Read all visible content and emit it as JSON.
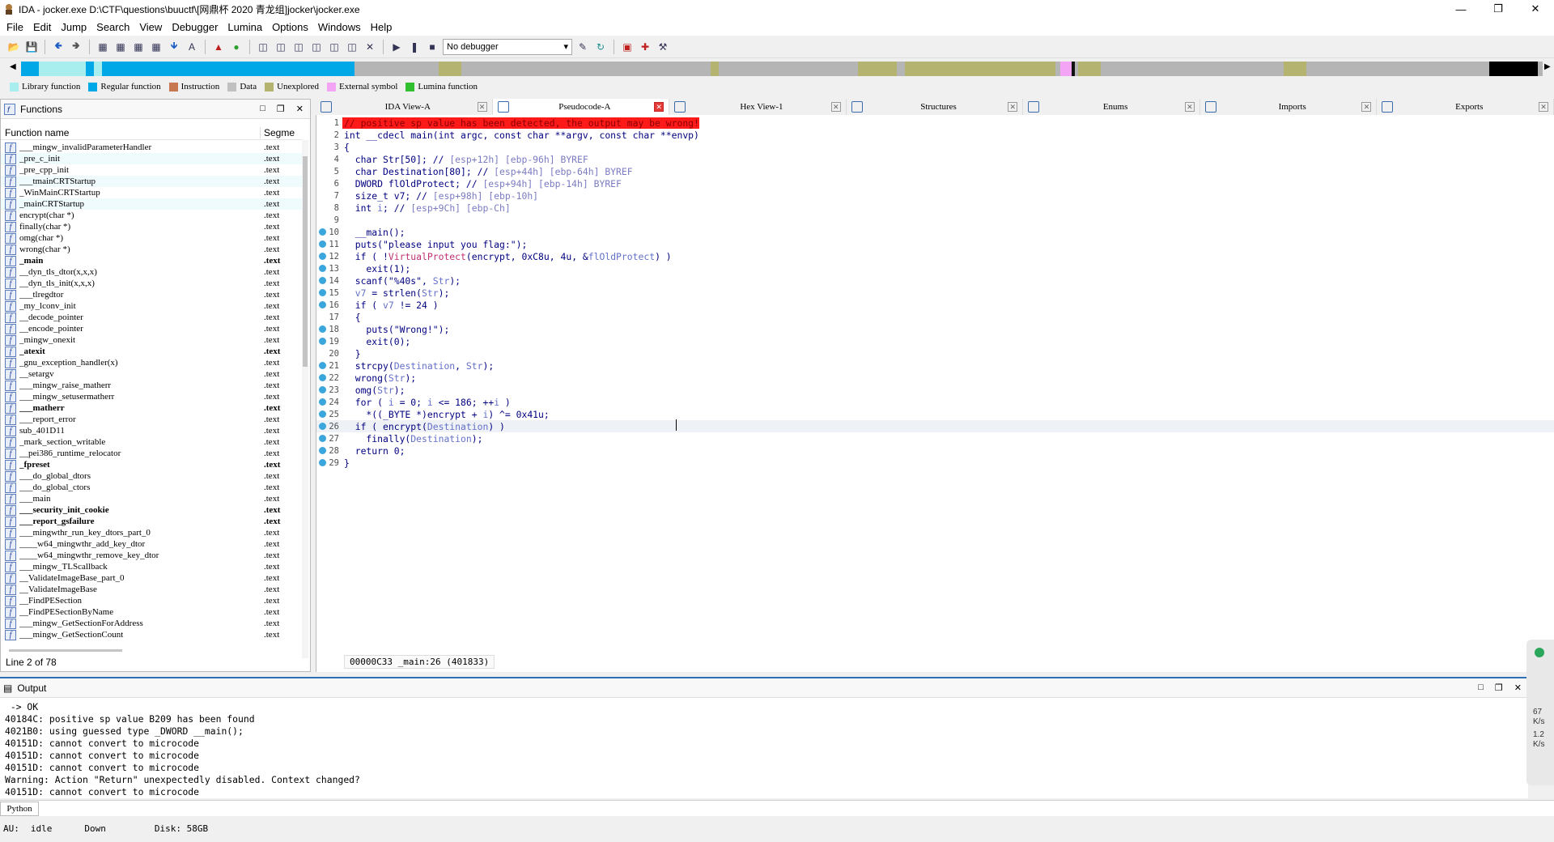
{
  "window": {
    "title": "IDA - jocker.exe D:\\CTF\\questions\\buuctf\\[网鼎杯 2020 青龙组]jocker\\jocker.exe"
  },
  "menu": [
    "File",
    "Edit",
    "Jump",
    "Search",
    "View",
    "Debugger",
    "Lumina",
    "Options",
    "Windows",
    "Help"
  ],
  "toolbar": {
    "debugger_select": "No debugger"
  },
  "legend": [
    {
      "label": "Library function",
      "color": "#a8eeee"
    },
    {
      "label": "Regular function",
      "color": "#00a8e8"
    },
    {
      "label": "Instruction",
      "color": "#c87850"
    },
    {
      "label": "Data",
      "color": "#c0c0c0"
    },
    {
      "label": "Unexplored",
      "color": "#b4b470"
    },
    {
      "label": "External symbol",
      "color": "#f4a4f4"
    },
    {
      "label": "Lumina function",
      "color": "#30c030"
    }
  ],
  "functions": {
    "title": "Functions",
    "col_name": "Function name",
    "col_segment": "Segme",
    "status": "Line 2 of 78",
    "items": [
      {
        "name": "___mingw_invalidParameterHandler",
        "seg": ".text",
        "bold": false
      },
      {
        "name": "_pre_c_init",
        "seg": ".text",
        "bold": false
      },
      {
        "name": "_pre_cpp_init",
        "seg": ".text",
        "bold": false
      },
      {
        "name": "___tmainCRTStartup",
        "seg": ".text",
        "bold": false
      },
      {
        "name": "_WinMainCRTStartup",
        "seg": ".text",
        "bold": false
      },
      {
        "name": "_mainCRTStartup",
        "seg": ".text",
        "bold": false
      },
      {
        "name": "encrypt(char *)",
        "seg": ".text",
        "bold": false
      },
      {
        "name": "finally(char *)",
        "seg": ".text",
        "bold": false
      },
      {
        "name": "omg(char *)",
        "seg": ".text",
        "bold": false
      },
      {
        "name": "wrong(char *)",
        "seg": ".text",
        "bold": false
      },
      {
        "name": "_main",
        "seg": ".text",
        "bold": true
      },
      {
        "name": "__dyn_tls_dtor(x,x,x)",
        "seg": ".text",
        "bold": false
      },
      {
        "name": "__dyn_tls_init(x,x,x)",
        "seg": ".text",
        "bold": false
      },
      {
        "name": "___tlregdtor",
        "seg": ".text",
        "bold": false
      },
      {
        "name": "_my_lconv_init",
        "seg": ".text",
        "bold": false
      },
      {
        "name": "__decode_pointer",
        "seg": ".text",
        "bold": false
      },
      {
        "name": "__encode_pointer",
        "seg": ".text",
        "bold": false
      },
      {
        "name": "_mingw_onexit",
        "seg": ".text",
        "bold": false
      },
      {
        "name": "_atexit",
        "seg": ".text",
        "bold": true
      },
      {
        "name": "_gnu_exception_handler(x)",
        "seg": ".text",
        "bold": false
      },
      {
        "name": "__setargv",
        "seg": ".text",
        "bold": false
      },
      {
        "name": "___mingw_raise_matherr",
        "seg": ".text",
        "bold": false
      },
      {
        "name": "___mingw_setusermatherr",
        "seg": ".text",
        "bold": false
      },
      {
        "name": "___matherr",
        "seg": ".text",
        "bold": true
      },
      {
        "name": "___report_error",
        "seg": ".text",
        "bold": false
      },
      {
        "name": "sub_401D11",
        "seg": ".text",
        "bold": false
      },
      {
        "name": "_mark_section_writable",
        "seg": ".text",
        "bold": false
      },
      {
        "name": "__pei386_runtime_relocator",
        "seg": ".text",
        "bold": false
      },
      {
        "name": "_fpreset",
        "seg": ".text",
        "bold": true
      },
      {
        "name": "___do_global_dtors",
        "seg": ".text",
        "bold": false
      },
      {
        "name": "___do_global_ctors",
        "seg": ".text",
        "bold": false
      },
      {
        "name": "___main",
        "seg": ".text",
        "bold": false
      },
      {
        "name": "___security_init_cookie",
        "seg": ".text",
        "bold": true
      },
      {
        "name": "___report_gsfailure",
        "seg": ".text",
        "bold": true
      },
      {
        "name": "___mingwthr_run_key_dtors_part_0",
        "seg": ".text",
        "bold": false
      },
      {
        "name": "____w64_mingwthr_add_key_dtor",
        "seg": ".text",
        "bold": false
      },
      {
        "name": "____w64_mingwthr_remove_key_dtor",
        "seg": ".text",
        "bold": false
      },
      {
        "name": "___mingw_TLScallback",
        "seg": ".text",
        "bold": false
      },
      {
        "name": "__ValidateImageBase_part_0",
        "seg": ".text",
        "bold": false
      },
      {
        "name": "__ValidateImageBase",
        "seg": ".text",
        "bold": false
      },
      {
        "name": "__FindPESection",
        "seg": ".text",
        "bold": false
      },
      {
        "name": "__FindPESectionByName",
        "seg": ".text",
        "bold": false
      },
      {
        "name": "___mingw_GetSectionForAddress",
        "seg": ".text",
        "bold": false
      },
      {
        "name": "___mingw_GetSectionCount",
        "seg": ".text",
        "bold": false
      }
    ]
  },
  "tabs": [
    {
      "label": "IDA View-A",
      "active": false
    },
    {
      "label": "Pseudocode-A",
      "active": true
    },
    {
      "label": "Hex View-1",
      "active": false
    },
    {
      "label": "Structures",
      "active": false
    },
    {
      "label": "Enums",
      "active": false
    },
    {
      "label": "Imports",
      "active": false
    },
    {
      "label": "Exports",
      "active": false
    }
  ],
  "code": {
    "address_bar": "00000C33 _main:26 (401833)",
    "lines": [
      {
        "n": "1",
        "dot": false,
        "warn": true,
        "html": "// positive sp value has been detected, the output may be wrong!"
      },
      {
        "n": "2",
        "dot": false,
        "warn": false,
        "html": "int __cdecl main(int argc, const char **argv, const char **envp)"
      },
      {
        "n": "3",
        "dot": false,
        "warn": false,
        "html": "{"
      },
      {
        "n": "4",
        "dot": false,
        "warn": false,
        "html": "  char Str[50]; // <span class='c-gy'>[esp+12h] [ebp-96h] BYREF</span>"
      },
      {
        "n": "5",
        "dot": false,
        "warn": false,
        "html": "  char Destination[80]; // <span class='c-gy'>[esp+44h] [ebp-64h] BYREF</span>"
      },
      {
        "n": "6",
        "dot": false,
        "warn": false,
        "html": "  DWORD flOldProtect; // <span class='c-gy'>[esp+94h] [ebp-14h] BYREF</span>"
      },
      {
        "n": "7",
        "dot": false,
        "warn": false,
        "html": "  size_t v7; // <span class='c-gy'>[esp+98h] [ebp-10h]</span>"
      },
      {
        "n": "8",
        "dot": false,
        "warn": false,
        "html": "  int <span class='c-vr'>i</span>; // <span class='c-gy'>[esp+9Ch] [ebp-Ch]</span>"
      },
      {
        "n": "9",
        "dot": false,
        "warn": false,
        "html": ""
      },
      {
        "n": "10",
        "dot": true,
        "warn": false,
        "html": "  __main();"
      },
      {
        "n": "11",
        "dot": true,
        "warn": false,
        "html": "  puts(\"please input you flag:\");"
      },
      {
        "n": "12",
        "dot": true,
        "warn": false,
        "html": "  if ( !<span class='c-fn'>VirtualProtect</span>(encrypt, 0xC8u, 4u, &amp;<span class='c-vr'>flOldProtect</span>) )"
      },
      {
        "n": "13",
        "dot": true,
        "warn": false,
        "html": "    exit(1);"
      },
      {
        "n": "14",
        "dot": true,
        "warn": false,
        "html": "  scanf(\"%40s\", <span class='c-vr'>Str</span>);"
      },
      {
        "n": "15",
        "dot": true,
        "warn": false,
        "html": "  <span class='c-vr'>v7</span> = strlen(<span class='c-vr'>Str</span>);"
      },
      {
        "n": "16",
        "dot": true,
        "warn": false,
        "html": "  if ( <span class='c-vr'>v7</span> != 24 )"
      },
      {
        "n": "17",
        "dot": false,
        "warn": false,
        "html": "  {"
      },
      {
        "n": "18",
        "dot": true,
        "warn": false,
        "html": "    puts(\"Wrong!\");"
      },
      {
        "n": "19",
        "dot": true,
        "warn": false,
        "html": "    exit(0);"
      },
      {
        "n": "20",
        "dot": false,
        "warn": false,
        "html": "  }"
      },
      {
        "n": "21",
        "dot": true,
        "warn": false,
        "html": "  strcpy(<span class='c-vr'>Destination</span>, <span class='c-vr'>Str</span>);"
      },
      {
        "n": "22",
        "dot": true,
        "warn": false,
        "html": "  wrong(<span class='c-vr'>Str</span>);"
      },
      {
        "n": "23",
        "dot": true,
        "warn": false,
        "html": "  omg(<span class='c-vr'>Str</span>);"
      },
      {
        "n": "24",
        "dot": true,
        "warn": false,
        "html": "  for ( <span class='c-vr'>i</span> = 0; <span class='c-vr'>i</span> &lt;= 186; ++<span class='c-vr'>i</span> )"
      },
      {
        "n": "25",
        "dot": true,
        "warn": false,
        "html": "    *((_BYTE *)encrypt + <span class='c-vr'>i</span>) ^= 0x41u;"
      },
      {
        "n": "26",
        "dot": true,
        "warn": false,
        "cur": true,
        "html": "  if ( encrypt(<span class='c-vr'>Destination</span>) )"
      },
      {
        "n": "27",
        "dot": true,
        "warn": false,
        "html": "    finally(<span class='c-vr'>Destination</span>);"
      },
      {
        "n": "28",
        "dot": true,
        "warn": false,
        "html": "  return 0;"
      },
      {
        "n": "29",
        "dot": true,
        "warn": false,
        "html": "}"
      }
    ]
  },
  "output": {
    "title": "Output",
    "lines": [
      " -> OK",
      "40184C: positive sp value B209 has been found",
      "4021B0: using guessed type _DWORD __main();",
      "40151D: cannot convert to microcode",
      "40151D: cannot convert to microcode",
      "40151D: cannot convert to microcode",
      "Warning: Action \"Return\" unexpectedly disabled. Context changed?",
      "40151D: cannot convert to microcode"
    ],
    "lang": "Python"
  },
  "status": {
    "au": "AU:",
    "state": "idle",
    "dir": "Down",
    "disk": "Disk: 58GB"
  },
  "widget": {
    "v1": "67",
    "u1": "K/s",
    "v2": "1.2",
    "u2": "K/s"
  }
}
